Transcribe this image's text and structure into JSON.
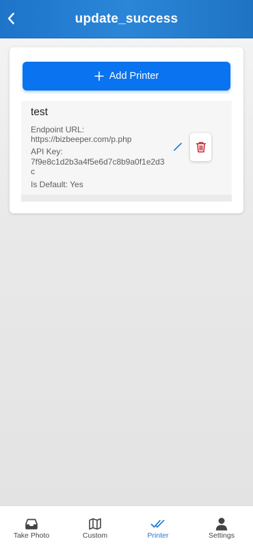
{
  "header": {
    "title": "update_success",
    "back_icon": "chevron-left-icon"
  },
  "add_printer": {
    "label": "Add Printer",
    "icon": "plus-icon"
  },
  "printers": [
    {
      "name": "test",
      "endpoint_label": "Endpoint URL:",
      "endpoint_value": "https://bizbeeper.com/p.php",
      "api_key_label": "API Key:",
      "api_key_value": "7f9e8c1d2b3a4f5e6d7c8b9a0f1e2d3c",
      "default_text": "Is Default: Yes"
    }
  ],
  "tabs": [
    {
      "label": "Take Photo",
      "icon": "inbox-tray-icon",
      "active": false
    },
    {
      "label": "Custom",
      "icon": "map-icon",
      "active": false
    },
    {
      "label": "Printer",
      "icon": "double-check-icon",
      "active": true
    },
    {
      "label": "Settings",
      "icon": "person-icon",
      "active": false
    }
  ],
  "colors": {
    "header": "#2b86d8",
    "primary_button": "#0a73ef",
    "active_tab": "#1a78d8",
    "delete": "#c8232c"
  }
}
